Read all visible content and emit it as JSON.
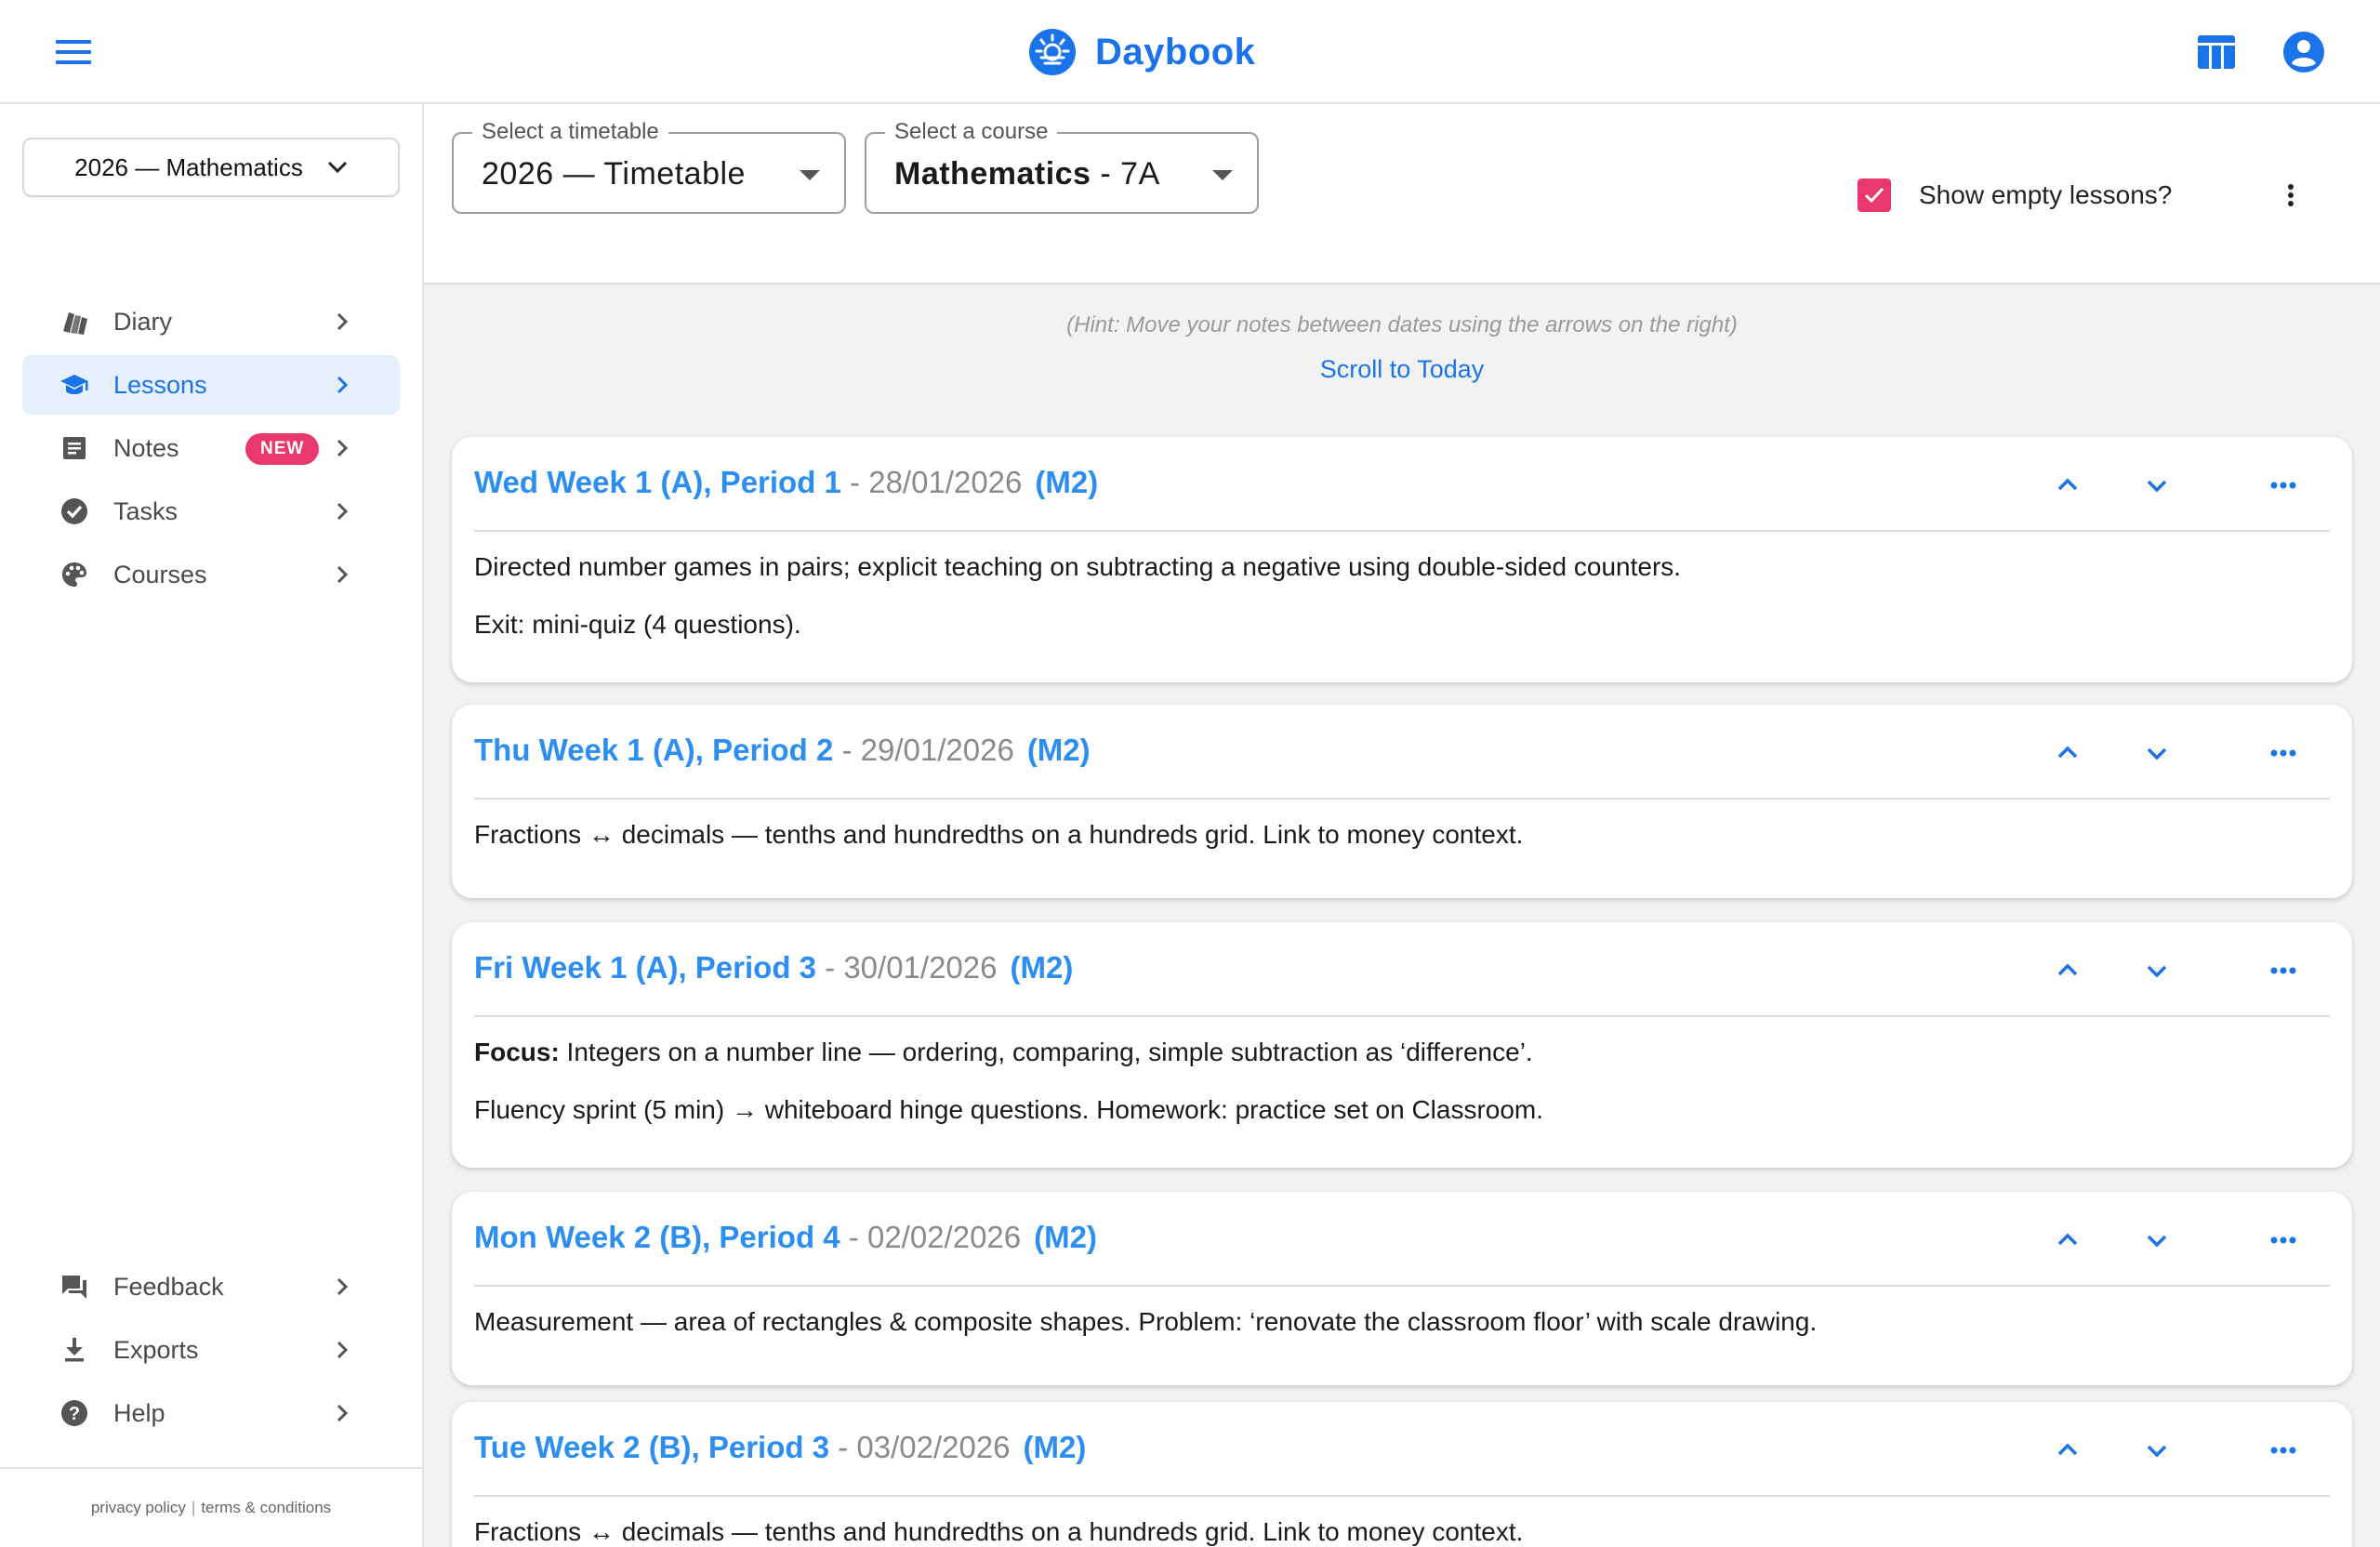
{
  "app": {
    "name": "Daybook",
    "brand_color": "#1a73e8",
    "accent_pink": "#e8386d"
  },
  "sidebar": {
    "year_select": "2026 — Mathematics",
    "items": [
      {
        "label": "Diary",
        "icon": "diary-icon"
      },
      {
        "label": "Lessons",
        "icon": "graduation-cap-icon",
        "active": true
      },
      {
        "label": "Notes",
        "icon": "notes-icon",
        "badge": "NEW"
      },
      {
        "label": "Tasks",
        "icon": "check-circle-icon"
      },
      {
        "label": "Courses",
        "icon": "palette-icon"
      }
    ],
    "bottom_items": [
      {
        "label": "Feedback",
        "icon": "feedback-icon"
      },
      {
        "label": "Exports",
        "icon": "download-icon"
      },
      {
        "label": "Help",
        "icon": "help-icon"
      }
    ],
    "footer": {
      "privacy": "privacy policy",
      "separator": "|",
      "terms": "terms & conditions"
    }
  },
  "toolbar": {
    "timetable": {
      "legend": "Select a timetable",
      "value": "2026 — Timetable"
    },
    "course": {
      "legend": "Select a course",
      "value_bold": "Mathematics",
      "value_rest": " - 7A"
    },
    "show_empty": {
      "label": "Show empty lessons?",
      "checked": true
    }
  },
  "content": {
    "hint": "(Hint: Move your notes between dates using the arrows on the right)",
    "scroll_today": "Scroll to Today",
    "lessons": [
      {
        "title": "Wed Week 1 (A), Period 1",
        "dash": " - ",
        "date": "28/01/2026",
        "code": "(M2)",
        "body": [
          {
            "text": "Directed number games in pairs; explicit teaching on subtracting a negative using double-sided counters."
          },
          {
            "text": "Exit: mini-quiz (4 questions)."
          }
        ]
      },
      {
        "title": "Thu Week 1 (A), Period 2",
        "dash": " - ",
        "date": "29/01/2026",
        "code": "(M2)",
        "body": [
          {
            "text": "Fractions ↔ decimals — tenths and hundredths on a hundreds grid. Link to money context."
          }
        ]
      },
      {
        "title": "Fri Week 1 (A), Period 3",
        "dash": " - ",
        "date": "30/01/2026",
        "code": "(M2)",
        "body": [
          {
            "bold": "Focus:",
            "text": " Integers on a number line — ordering, comparing, simple subtraction as ‘difference’."
          },
          {
            "text": "Fluency sprint (5 min) → whiteboard hinge questions. Homework: practice set on Classroom."
          }
        ]
      },
      {
        "title": "Mon Week 2 (B), Period 4",
        "dash": " - ",
        "date": "02/02/2026",
        "code": "(M2)",
        "body": [
          {
            "text": "Measurement — area of rectangles & composite shapes. Problem: ‘renovate the classroom floor’ with scale drawing."
          }
        ]
      },
      {
        "title": "Tue Week 2 (B), Period 3",
        "dash": " - ",
        "date": "03/02/2026",
        "code": "(M2)",
        "body": [
          {
            "text": "Fractions ↔ decimals — tenths and hundredths on a hundreds grid. Link to money context."
          }
        ]
      }
    ]
  }
}
